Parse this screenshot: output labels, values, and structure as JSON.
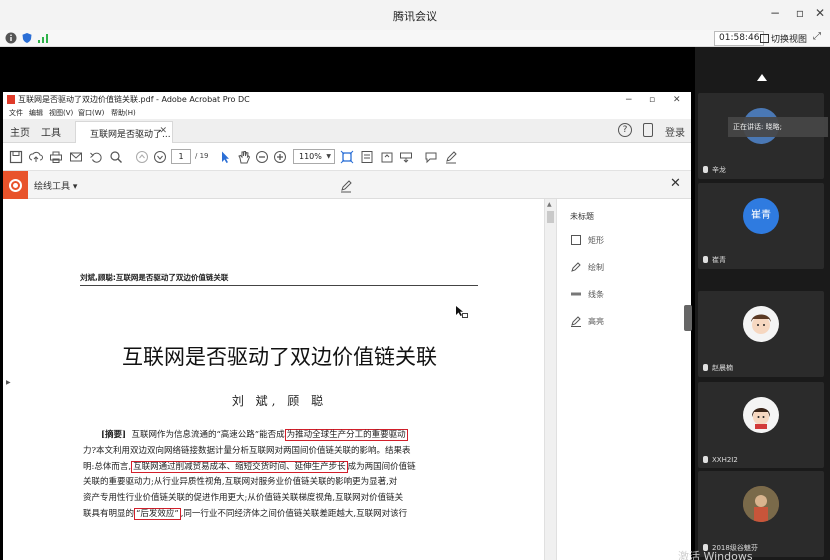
{
  "meeting": {
    "title": "腾讯会议",
    "timer": "01:58:46",
    "switch_view": "切换视图"
  },
  "acrobat": {
    "window_title": "互联网是否驱动了双边价值链关联.pdf - Adobe Acrobat Pro DC",
    "menu": [
      "文件",
      "编辑",
      "视图(V)",
      "窗口(W)",
      "帮助(H)"
    ],
    "tabs": {
      "home": "主页",
      "tools": "工具",
      "doc": "互联网是否驱动了..."
    },
    "login": "登录",
    "help": "?",
    "page_current": "1",
    "page_total": "/ 19",
    "zoom": "110%",
    "draw_tools_label": "绘线工具 ▾"
  },
  "document": {
    "running_head": "刘斌,顾聪:互联网是否驱动了双边价值链关联",
    "title": "互联网是否驱动了双边价值链关联",
    "authors": "刘  斌, 顾  聪",
    "abstract_label": "[摘要]",
    "lines": [
      {
        "pre": "互联网作为信息流通的“高速公路”能否成",
        "hl": "为推动全球生产分工的重要驱动",
        "post": ""
      },
      {
        "pre": "力?本文利用双边双向网络链接数据计量分析互联网对两国间价值链关联的影响。结果表",
        "hl": "",
        "post": ""
      },
      {
        "pre": "明:总体而言,",
        "hl": "互联网通过削减贸易成本、缩短交货时间、延伸生产步长",
        "post": "成为两国间价值链"
      },
      {
        "pre": "关联的重要驱动力;从行业异质性视角,互联网对服务业价值链关联的影响更为显著,对",
        "hl": "",
        "post": ""
      },
      {
        "pre": "资产专用性行业价值链关联的促进作用更大;从价值链关联梯度视角,互联网对价值链关",
        "hl": "",
        "post": ""
      },
      {
        "pre": "联具有明显的",
        "hl": "“后发效应”",
        "post": ",同一行业不同经济体之间价值链关联差距越大,互联网对该行"
      }
    ]
  },
  "right_pane": {
    "header": "未标题",
    "items": [
      "矩形",
      "绘制",
      "线条",
      "高亮"
    ]
  },
  "participants": {
    "speaking": "正在讲话: 晓略;",
    "tiles": [
      {
        "name": "辛龙",
        "color": "#4a78b5",
        "initials": ""
      },
      {
        "name": "崔青",
        "color": "#2f7be0",
        "initials": "崔青"
      },
      {
        "name": "赵晨楠",
        "color": "#f4f4f4",
        "initials": ""
      },
      {
        "name": "XXH2I2",
        "color": "#f4f4f4",
        "initials": ""
      },
      {
        "name": "2018级谷魅芬",
        "color": "#8a5a3a",
        "initials": ""
      }
    ]
  },
  "watermark": "激活 Windows"
}
